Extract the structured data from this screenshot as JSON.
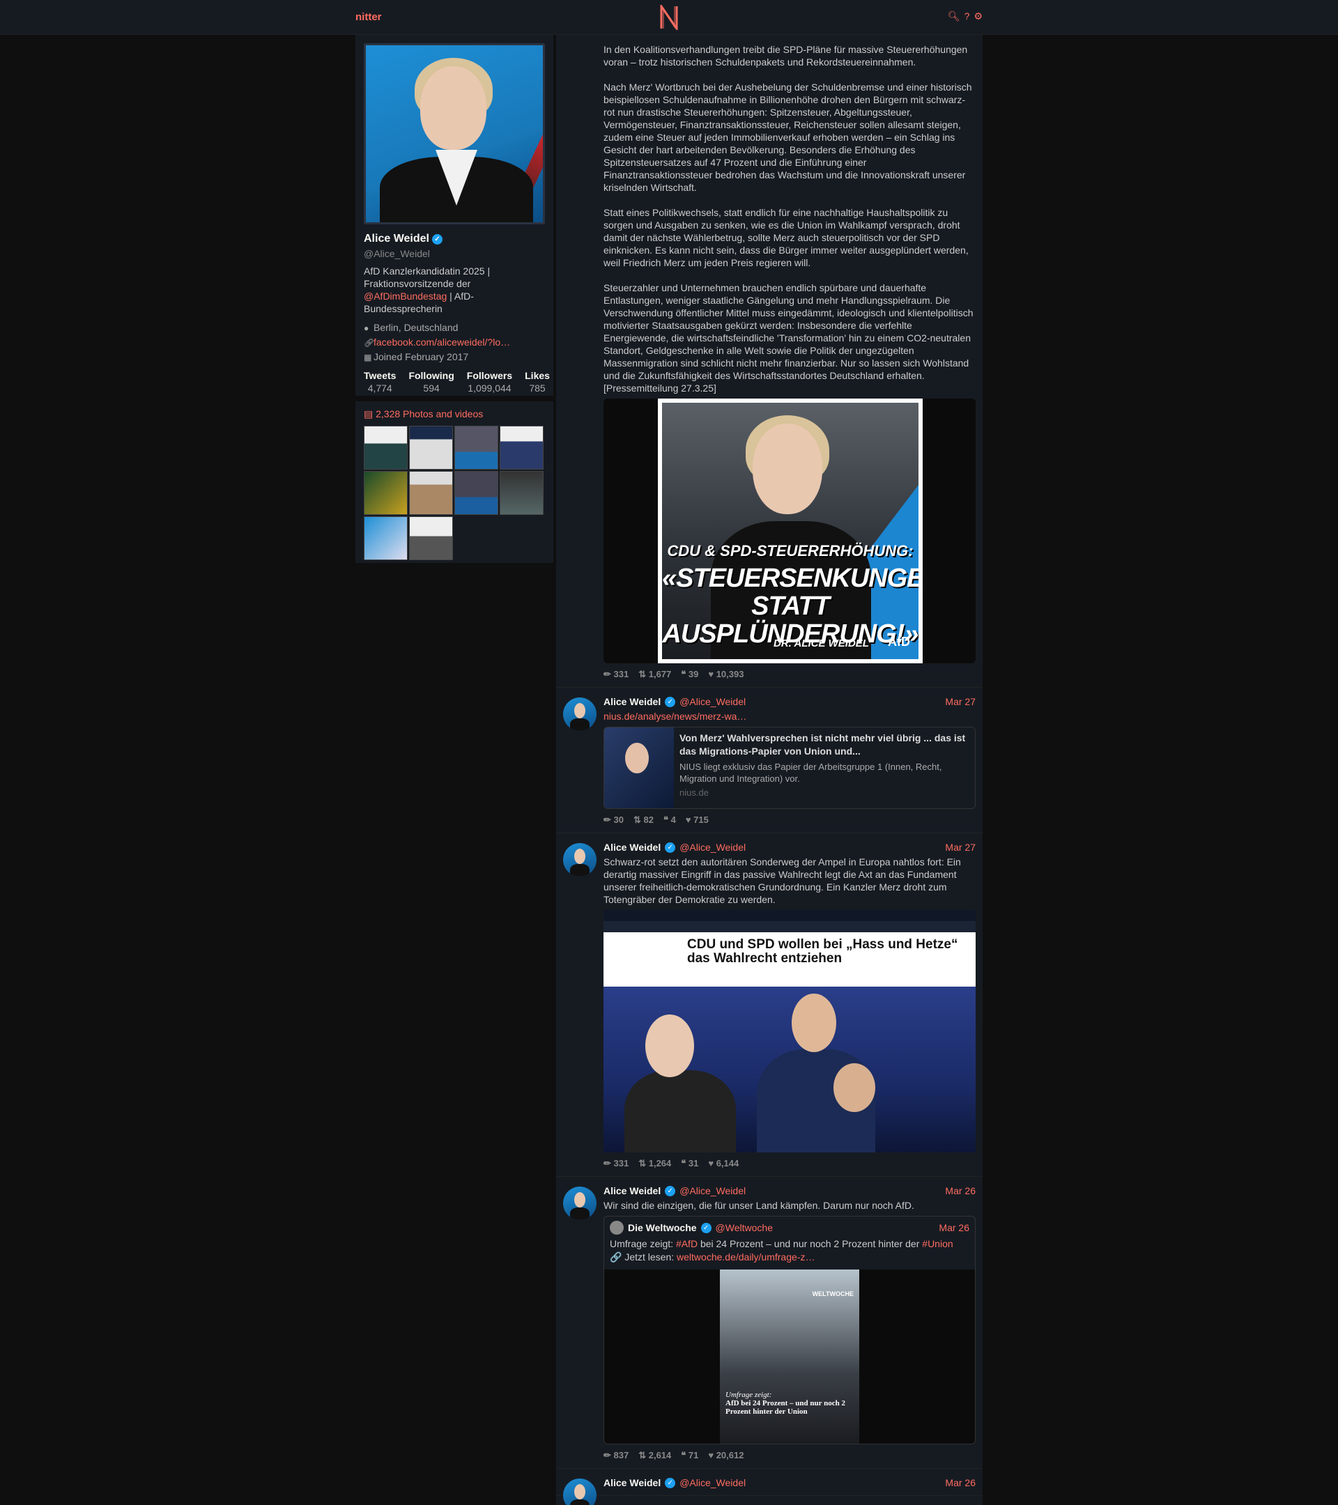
{
  "nav": {
    "brand": "nitter",
    "icons": [
      "search-icon",
      "help-icon",
      "settings-icon"
    ],
    "help_glyph": "?"
  },
  "profile": {
    "name": "Alice Weidel",
    "handle": "@Alice_Weidel",
    "bio_line1": "AfD Kanzlerkandidatin 2025 | Fraktionsvorsitzende der ",
    "bio_link": "@AfDimBundestag",
    "bio_line2": " | AfD-Bundessprecherin",
    "location": "Berlin, Deutschland",
    "website": "facebook.com/aliceweidel/?lo…",
    "joined": "Joined February 2017",
    "stats": [
      {
        "label": "Tweets",
        "value": "4,774"
      },
      {
        "label": "Following",
        "value": "594"
      },
      {
        "label": "Followers",
        "value": "1,099,044"
      },
      {
        "label": "Likes",
        "value": "785"
      }
    ],
    "media_title": "2,328 Photos and videos"
  },
  "tweets": [
    {
      "text": "In den Koalitionsverhandlungen treibt die SPD-Pläne für massive Steuererhöhungen voran – trotz historischen Schuldenpakets und Rekordsteuereinnahmen.\n\nNach Merz' Wortbruch bei der Aushebelung der Schuldenbremse und einer historisch beispiellosen Schuldenaufnahme in Billionenhöhe drohen den Bürgern mit schwarz-rot nun drastische Steuererhöhungen: Spitzensteuer, Abgeltungssteuer, Vermögensteuer, Finanztransaktionssteuer, Reichensteuer sollen allesamt steigen, zudem eine Steuer auf jeden Immobilienverkauf erhoben werden – ein Schlag ins Gesicht der hart arbeitenden Bevölkerung. Besonders die Erhöhung des Spitzensteuersatzes auf 47 Prozent und die Einführung einer Finanztransaktionssteuer bedrohen das Wachstum und die Innovationskraft unserer kriselnden Wirtschaft.\n\nStatt eines Politikwechsels, statt endlich für eine nachhaltige Haushaltspolitik zu sorgen und Ausgaben zu senken, wie es die Union im Wahlkampf versprach, droht damit der nächste Wählerbetrug, sollte Merz auch steuerpolitisch vor der SPD einknicken. Es kann nicht sein, dass die Bürger immer weiter ausgeplündert werden, weil Friedrich Merz um jeden Preis regieren will.\n\nSteuerzahler und Unternehmen brauchen endlich spürbare und dauerhafte Entlastungen, weniger staatliche Gängelung und mehr Handlungsspielraum. Die Verschwendung öffentlicher Mittel muss eingedämmt, ideologisch und klientelpolitisch motivierter Staatsausgaben gekürzt werden: Insbesondere die verfehlte Energiewende, die wirtschaftsfeindliche 'Transformation' hin zu einem CO2-neutralen Standort, Geldgeschenke in alle Welt sowie die Politik der ungezügelten Massenmigration sind schlicht nicht mehr finanzierbar. Nur so lassen sich Wohlstand und die Zukunftsfähigkeit des Wirtschaftsstandortes Deutschland erhalten. [Pressemitteilung 27.3.25]",
      "poster_line1": "CDU & SPD-STEUERERHÖHUNG:",
      "poster_line2": "«STEUERSENKUNGEN",
      "poster_line3": "STATT AUSPLÜNDERUNG!»",
      "poster_sign": "DR. ALICE WEIDEL",
      "poster_logo": "AfD",
      "stats": {
        "replies": "331",
        "retweets": "1,677",
        "quotes": "39",
        "likes": "10,393"
      }
    },
    {
      "name": "Alice Weidel",
      "handle": "@Alice_Weidel",
      "date": "Mar 27",
      "link": "nius.de/analyse/news/merz-wa…",
      "card_title": "Von Merz' Wahlversprechen ist nicht mehr viel übrig ... das ist das Migrations-Papier von Union und...",
      "card_desc": "NIUS liegt exklusiv das Papier der Arbeitsgruppe 1 (Innen, Recht, Migration und Integration) vor.",
      "card_dest": "nius.de",
      "stats": {
        "replies": "30",
        "retweets": "82",
        "quotes": "4",
        "likes": "715"
      }
    },
    {
      "name": "Alice Weidel",
      "handle": "@Alice_Weidel",
      "date": "Mar 27",
      "text": "Schwarz-rot setzt den autoritären Sonderweg der Ampel in Europa nahtlos fort: Ein derartig massiver Eingriff in das passive Wahlrecht legt die Axt an das Fundament unserer freiheitlich-demokratischen Grundordnung. Ein Kanzler Merz droht zum Totengräber der Demokratie zu werden.",
      "image_headline": "CDU und SPD wollen bei „Hass und Hetze“ das Wahlrecht entziehen",
      "stats": {
        "replies": "331",
        "retweets": "1,264",
        "quotes": "31",
        "likes": "6,144"
      }
    },
    {
      "name": "Alice Weidel",
      "handle": "@Alice_Weidel",
      "date": "Mar 26",
      "text": "Wir sind die einzigen, die für unser Land kämpfen. Darum nur noch AfD.",
      "quote": {
        "name": "Die Weltwoche",
        "handle": "@Weltwoche",
        "date": "Mar 26",
        "text_pre": "Umfrage zeigt: ",
        "tag1": "#AfD",
        "text_mid": " bei 24 Prozent – und nur noch 2 Prozent hinter der ",
        "tag2": "#Union",
        "text_link_pre": "🔗 Jetzt lesen: ",
        "link": "weltwoche.de/daily/umfrage-z…",
        "image_caption_italic": "Umfrage zeigt:",
        "image_caption": "AfD bei 24 Prozent – und nur noch 2 Prozent hinter der Union",
        "image_brand": "WELTWOCHE"
      },
      "stats": {
        "replies": "837",
        "retweets": "2,614",
        "quotes": "71",
        "likes": "20,612"
      }
    },
    {
      "name": "Alice Weidel",
      "handle": "@Alice_Weidel",
      "date": "Mar 26"
    }
  ]
}
